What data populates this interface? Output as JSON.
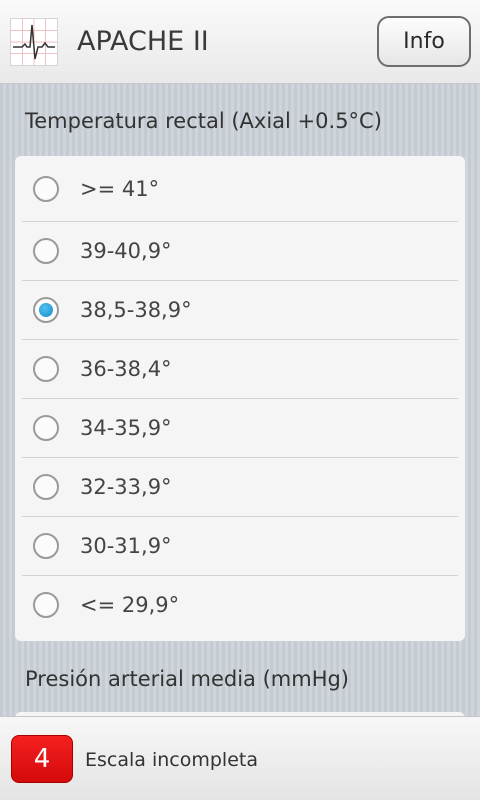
{
  "header": {
    "title": "APACHE II",
    "info_label": "Info",
    "icon": "ecg-icon"
  },
  "sections": [
    {
      "title": "Temperatura rectal (Axial +0.5°C)",
      "options": [
        {
          "label": ">= 41°",
          "checked": false
        },
        {
          "label": "39-40,9°",
          "checked": false
        },
        {
          "label": "38,5-38,9°",
          "checked": true
        },
        {
          "label": "36-38,4°",
          "checked": false
        },
        {
          "label": "34-35,9°",
          "checked": false
        },
        {
          "label": "32-33,9°",
          "checked": false
        },
        {
          "label": "30-31,9°",
          "checked": false
        },
        {
          "label": "<= 29,9°",
          "checked": false
        }
      ]
    },
    {
      "title": "Presión arterial media (mmHg)"
    }
  ],
  "footer": {
    "score": "4",
    "status": "Escala incompleta"
  },
  "colors": {
    "accent": "#1a8cc9",
    "score_badge": "#e61414"
  }
}
